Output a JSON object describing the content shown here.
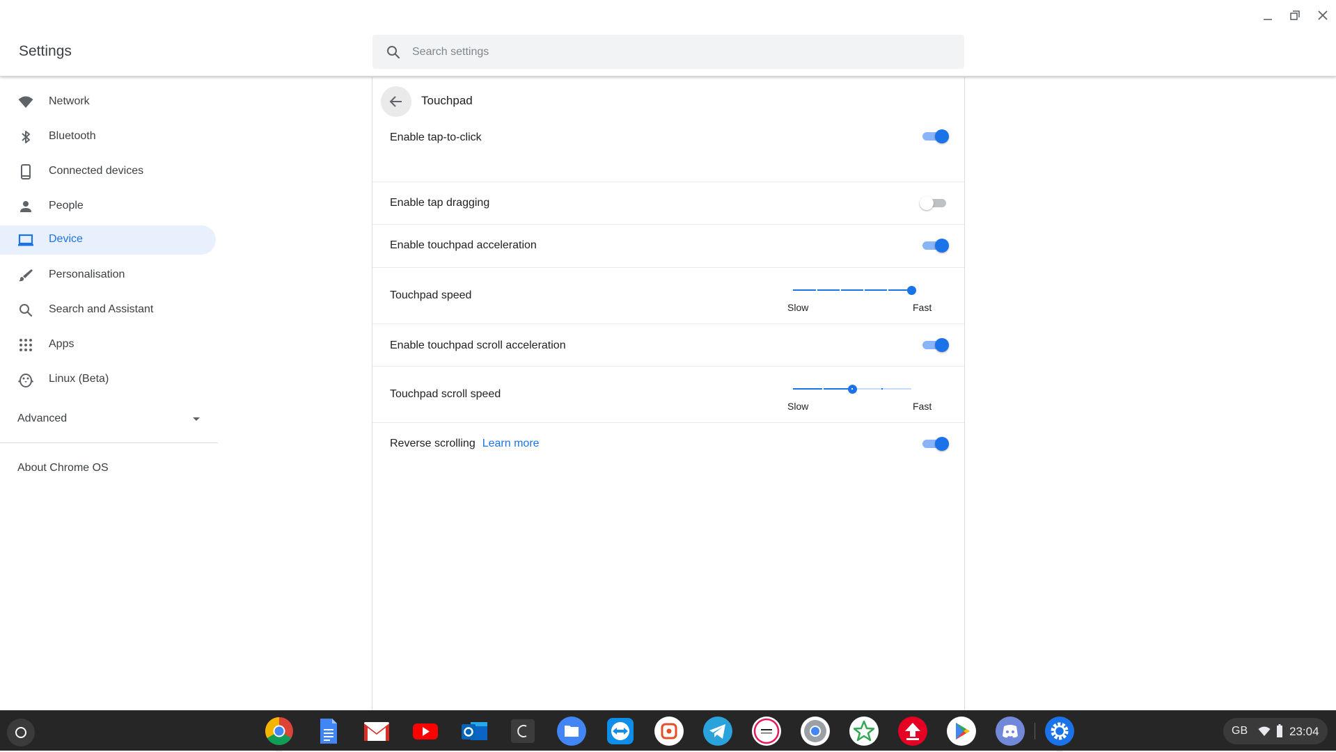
{
  "header": {
    "title": "Settings",
    "search_placeholder": "Search settings"
  },
  "sidebar": {
    "items": [
      {
        "label": "Network",
        "icon": "wifi-icon"
      },
      {
        "label": "Bluetooth",
        "icon": "bluetooth-icon"
      },
      {
        "label": "Connected devices",
        "icon": "phone-icon"
      },
      {
        "label": "People",
        "icon": "person-icon"
      },
      {
        "label": "Device",
        "icon": "laptop-icon",
        "selected": true
      },
      {
        "label": "Personalisation",
        "icon": "brush-icon"
      },
      {
        "label": "Search and Assistant",
        "icon": "search-icon"
      },
      {
        "label": "Apps",
        "icon": "apps-grid-icon"
      },
      {
        "label": "Linux (Beta)",
        "icon": "penguin-icon"
      }
    ],
    "advanced": "Advanced",
    "about": "About Chrome OS"
  },
  "main": {
    "title": "Touchpad",
    "rows": [
      {
        "label": "Enable tap-to-click",
        "type": "toggle",
        "on": true
      },
      {
        "label": "Enable tap dragging",
        "type": "toggle",
        "on": false
      },
      {
        "label": "Enable touchpad acceleration",
        "type": "toggle",
        "on": true
      },
      {
        "label": "Touchpad speed",
        "type": "slider",
        "value_step": 5,
        "max_step": 5,
        "min_label": "Slow",
        "max_label": "Fast"
      },
      {
        "label": "Enable touchpad scroll acceleration",
        "type": "toggle",
        "on": true
      },
      {
        "label": "Touchpad scroll speed",
        "type": "slider",
        "value_step": 2,
        "max_step": 4,
        "min_label": "Slow",
        "max_label": "Fast"
      },
      {
        "label": "Reverse scrolling",
        "type": "toggle",
        "on": true,
        "link": "Learn more"
      }
    ]
  },
  "shelf": {
    "apps": [
      "Chrome",
      "Google Docs",
      "Gmail",
      "YouTube",
      "Outlook",
      "Crostini Terminal",
      "Files",
      "TeamViewer",
      "Pixlr",
      "Telegram",
      "MDS Checker",
      "Chromium",
      "Star app",
      "Uploader",
      "Play Store",
      "Discord",
      "Settings"
    ],
    "ime": "GB",
    "time": "23:04"
  },
  "colors": {
    "accent": "#1a73e8",
    "selected_bg": "#e8f0fe",
    "shelf_bg": "#262626"
  }
}
